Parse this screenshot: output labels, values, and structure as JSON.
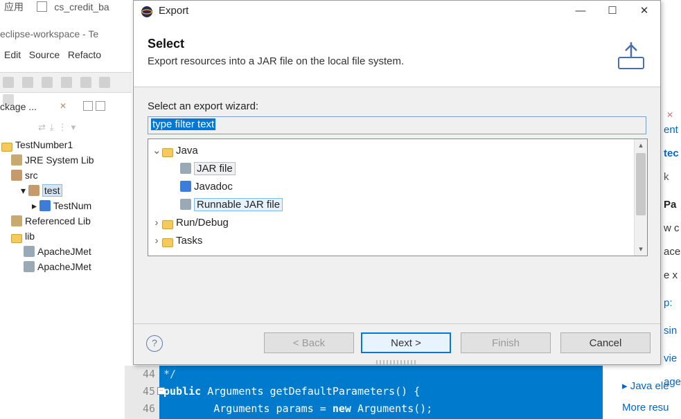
{
  "bg": {
    "tab_checkbox_label": "cs_credit_ba",
    "app_label": "应用",
    "workspace_title": "eclipse-workspace - Te",
    "menu": [
      "Edit",
      "Source",
      "Refacto"
    ],
    "package_view_tab": "ckage ...",
    "tree": {
      "root": "TestNumber1",
      "jre": "JRE System Lib",
      "src": "src",
      "pkg": "test",
      "cls": "TestNum",
      "ref": "Referenced Lib",
      "lib": "lib",
      "jar1": "ApacheJMet",
      "jar2": "ApacheJMet"
    }
  },
  "editor": {
    "lines": [
      "44",
      "45",
      "46"
    ],
    "code_comment": "*/",
    "code_l2a": "public",
    "code_l2b": " Arguments getDefaultParameters() {",
    "code_l3a": "        Arguments params = ",
    "code_l3b": "new",
    "code_l3c": " Arguments();"
  },
  "right": {
    "items": [
      "ent",
      "tec",
      "k",
      "Pa",
      "w c",
      "ace",
      "e x",
      "p:",
      "sin",
      "vie",
      "age",
      "Java ele",
      "More resu"
    ]
  },
  "dialog": {
    "title": "Export",
    "header": "Select",
    "desc": "Export resources into a JAR file on the local file system.",
    "body_label": "Select an export wizard:",
    "filter_text": "type filter text",
    "tree": {
      "java": "Java",
      "jar": "JAR file",
      "javadoc": "Javadoc",
      "runjar": "Runnable JAR file",
      "rundebug": "Run/Debug",
      "tasks": "Tasks"
    },
    "buttons": {
      "back": "< Back",
      "next": "Next >",
      "finish": "Finish",
      "cancel": "Cancel"
    }
  }
}
